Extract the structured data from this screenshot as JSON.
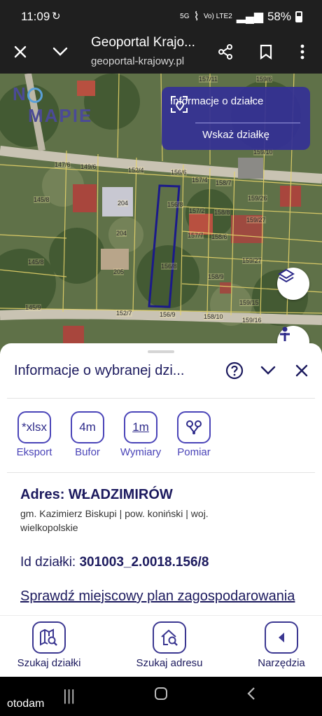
{
  "status_bar": {
    "time": "11:09",
    "network": "5G",
    "lte": "Vo) LTE2",
    "battery": "58%"
  },
  "browser": {
    "title": "Geoportal Krajo...",
    "url": "geoportal-krajowy.pl"
  },
  "map": {
    "logo": {
      "first": "N",
      "second": "MAPIE"
    },
    "panel": {
      "info_label": "Informacje o działce",
      "show_label": "Wskaż działkę"
    },
    "parcels": [
      "157/11",
      "159/6",
      "159/10",
      "147/6",
      "149/6",
      "152/4",
      "156/6",
      "157/4",
      "158/7",
      "145/8",
      "204",
      "156/8",
      "157/2",
      "158/8",
      "159/26",
      "159/27",
      "204",
      "157/7",
      "158/6",
      "145/8",
      "205",
      "156/8",
      "159/27",
      "158/9",
      "145/9",
      "152/7",
      "156/9",
      "158/10",
      "159/15",
      "159/16"
    ]
  },
  "sheet": {
    "title": "Informacje o wybranej dzi...",
    "tools": [
      {
        "icon": "*xlsx",
        "label": "Eksport"
      },
      {
        "icon": "4m",
        "label": "Bufor"
      },
      {
        "icon": "1m",
        "label": "Wymiary"
      },
      {
        "icon": "",
        "label": "Pomiar"
      }
    ],
    "address_key": "Adres:",
    "address_value": "WŁADZIMIRÓW",
    "admin": "gm. Kazimierz Biskupi | pow. koniński | woj. wielkopolskie",
    "parcel_id_key": "Id działki:",
    "parcel_id_value": "301003_2.0018.156/8",
    "plan_link": "Sprawdź miejscowy plan zagospodarowania"
  },
  "bottom_nav": [
    {
      "label": "Szukaj działki"
    },
    {
      "label": "Szukaj adresu"
    },
    {
      "label": "Narzędzia"
    }
  ],
  "system": {
    "watermark": "otodam"
  },
  "colors": {
    "accent": "#3b3791",
    "title": "#1c1a5e",
    "panel": "#3430a0",
    "parcel_outline": "#1b1a8a"
  }
}
